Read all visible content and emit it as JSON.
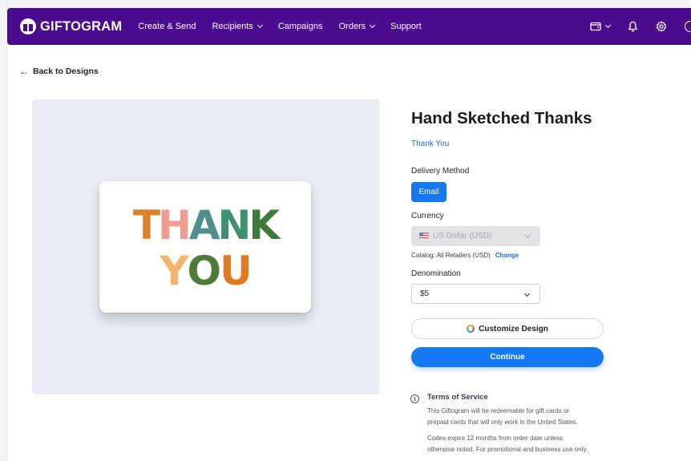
{
  "nav": {
    "logo": "GIFTOGRAM",
    "items": [
      {
        "label": "Create & Send",
        "dropdown": false
      },
      {
        "label": "Recipients",
        "dropdown": true
      },
      {
        "label": "Campaigns",
        "dropdown": false
      },
      {
        "label": "Orders",
        "dropdown": true
      },
      {
        "label": "Support",
        "dropdown": false
      }
    ],
    "icons": [
      "wallet-icon",
      "bell-icon",
      "gear-icon"
    ],
    "brand_color": "#4b0b8f"
  },
  "back_label": "Back to Designs",
  "card": {
    "line1": [
      "T",
      "H",
      "A",
      "N",
      "K"
    ],
    "line2": [
      "Y",
      "O",
      "U"
    ],
    "line1_colors": [
      "#d9822b",
      "#f29b91",
      "#4e8f8a",
      "#3f8f70",
      "#3d7a3c"
    ],
    "line2_colors": [
      "#f5b66b",
      "#4f7a3a",
      "#e07b1f"
    ]
  },
  "product": {
    "title": "Hand Sketched Thanks",
    "category": "Thank You"
  },
  "delivery": {
    "label": "Delivery Method",
    "option": "Email"
  },
  "currency": {
    "label": "Currency",
    "value": "US Dollar (USD)",
    "catalog_text": "Catalog: All Retailers (USD)",
    "change_label": "Change"
  },
  "denomination": {
    "label": "Denomination",
    "value": "$5"
  },
  "buttons": {
    "customize": "Customize Design",
    "continue": "Continue"
  },
  "tos": {
    "title": "Terms of Service",
    "p1_line1": "This Giftogram will be redeemable for gift cards or",
    "p1_line2": "prepaid cards that will only work in the United States.",
    "p2_line1": "Codes expire 12 months from order date unless",
    "p2_line2": "otherwise noted. For promotional and business use only."
  },
  "accent_color": "#1479f2"
}
